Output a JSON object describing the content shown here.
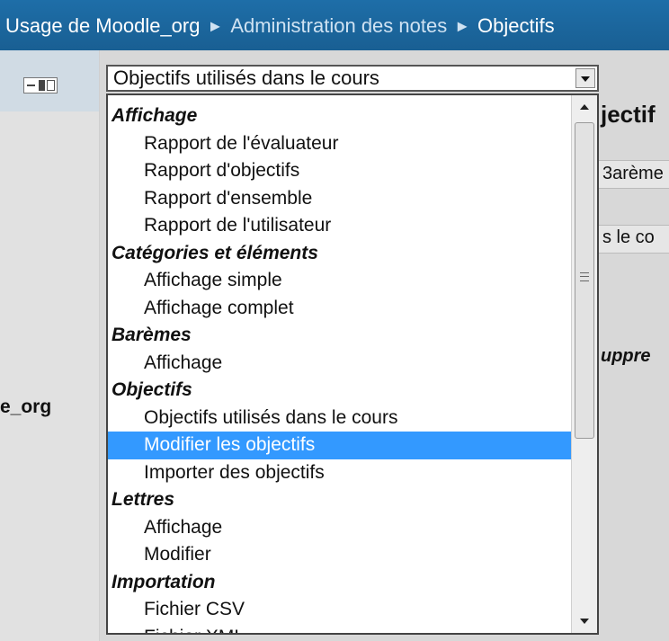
{
  "breadcrumb": {
    "items": [
      "Usage de Moodle_org",
      "Administration des notes",
      "Objectifs"
    ],
    "separator": "►"
  },
  "background": {
    "course_name_fragment": "e_org",
    "heading_fragment": "jectif",
    "bareme_fragment": "3arème",
    "cours_fragment": "s le co",
    "suppr_fragment": "uppre"
  },
  "select": {
    "value": "Objectifs utilisés dans le cours"
  },
  "dropdown": {
    "options": [
      {
        "label": "Affichage",
        "type": "group"
      },
      {
        "label": "Rapport de l'évaluateur",
        "type": "option"
      },
      {
        "label": "Rapport d'objectifs",
        "type": "option"
      },
      {
        "label": "Rapport d'ensemble",
        "type": "option"
      },
      {
        "label": "Rapport de l'utilisateur",
        "type": "option"
      },
      {
        "label": "Catégories et éléments",
        "type": "group"
      },
      {
        "label": "Affichage simple",
        "type": "option"
      },
      {
        "label": "Affichage complet",
        "type": "option"
      },
      {
        "label": "Barèmes",
        "type": "group"
      },
      {
        "label": "Affichage",
        "type": "option"
      },
      {
        "label": "Objectifs",
        "type": "group"
      },
      {
        "label": "Objectifs utilisés dans le cours",
        "type": "option"
      },
      {
        "label": "Modifier les objectifs",
        "type": "option",
        "selected": true
      },
      {
        "label": "Importer des objectifs",
        "type": "option"
      },
      {
        "label": "Lettres",
        "type": "group"
      },
      {
        "label": "Affichage",
        "type": "option"
      },
      {
        "label": "Modifier",
        "type": "option"
      },
      {
        "label": "Importation",
        "type": "group"
      },
      {
        "label": "Fichier CSV",
        "type": "option"
      },
      {
        "label": "Fichier XML",
        "type": "option"
      }
    ]
  },
  "colors": {
    "topbar": "#1e6ea8",
    "selection": "#3399ff"
  }
}
